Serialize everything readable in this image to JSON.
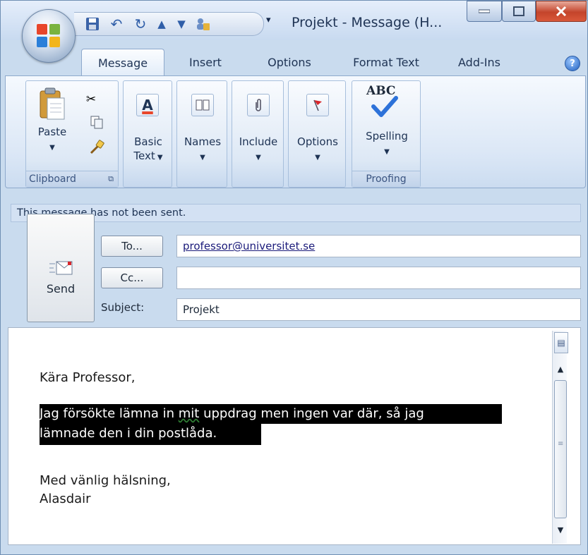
{
  "window": {
    "title": "Projekt - Message (H...",
    "qat_dropdown": "▾"
  },
  "ribbon": {
    "tabs": [
      {
        "label": "Message",
        "active": true
      },
      {
        "label": "Insert",
        "active": false
      },
      {
        "label": "Options",
        "active": false
      },
      {
        "label": "Format Text",
        "active": false
      },
      {
        "label": "Add-Ins",
        "active": false
      }
    ],
    "help": "?",
    "groups": {
      "clipboard": {
        "label": "Clipboard",
        "paste": "Paste"
      },
      "basic_text": {
        "label_line1": "Basic",
        "label_line2": "Text",
        "icon_letter": "A"
      },
      "names": {
        "label": "Names"
      },
      "include": {
        "label": "Include"
      },
      "options": {
        "label": "Options"
      },
      "proofing": {
        "label": "Proofing",
        "spelling": "Spelling",
        "icon_text": "ABC"
      }
    }
  },
  "compose": {
    "info": "This message has not been sent.",
    "send": "Send",
    "to_button": "To...",
    "cc_button": "Cc...",
    "subject_label": "Subject:",
    "to_value": "professor@universitet.se",
    "cc_value": "",
    "subject_value": "Projekt"
  },
  "body": {
    "greeting": "Kära Professor,",
    "para_line1_a": "Jag försökte lämna in ",
    "para_line1_err": "mit",
    "para_line1_b": " uppdrag men ingen var där, så jag",
    "para_line2": "lämnade den i din postlåda.",
    "closing": "Med vänlig hälsning,",
    "signature": "Alasdair"
  },
  "colors": {
    "window_frame": "#c9dbee",
    "highlight_bg": "#000000",
    "highlight_text": "#ffffff",
    "close_button": "#c4442b"
  }
}
